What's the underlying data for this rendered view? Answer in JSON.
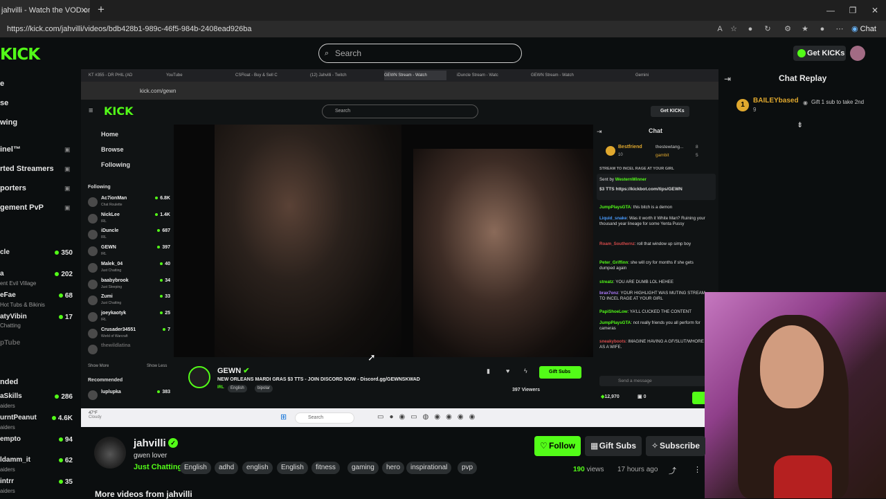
{
  "browser": {
    "tab_title": "jahvilli - Watch the VOD on K",
    "url": "https://kick.com/jahvilli/videos/bdb428b1-989c-46f5-984b-2408ead926ba",
    "chat_button": "Chat"
  },
  "header": {
    "logo": "KICK",
    "search_placeholder": "Search",
    "get_kicks": "Get KICKs"
  },
  "sidebar": {
    "nav": [
      "e",
      "se",
      "wing"
    ],
    "pinned": [
      "inel™",
      "rted Streamers",
      "porters",
      "gement PvP"
    ],
    "streams": [
      {
        "name": "cle",
        "sub": "",
        "count": "350"
      },
      {
        "name": "a",
        "sub": "ent Evil Village",
        "count": "202"
      },
      {
        "name": "eFae",
        "sub": "Hot Tubs & Bikinis",
        "count": "68"
      },
      {
        "name": "atyVibin",
        "sub": "Chatting",
        "count": "17"
      },
      {
        "name": "pTube",
        "sub": "",
        "count": ""
      }
    ],
    "section2": "nded",
    "streams2": [
      {
        "name": "aSkills",
        "sub": "aiders",
        "count": "286"
      },
      {
        "name": "urntPeanut",
        "sub": "aiders",
        "count": "4.6K"
      },
      {
        "name": "empto",
        "sub": "",
        "count": "94"
      },
      {
        "name": "ldamm_it",
        "sub": "aiders",
        "count": "62"
      },
      {
        "name": "intrr",
        "sub": "aiders",
        "count": "35"
      }
    ]
  },
  "embedded": {
    "tabs": [
      "KT #355 - DR PHIL (AD",
      "YouTube",
      "CSFloat - Buy & Sell C",
      "(12) Jahvilli - Twitch",
      "GEWN Stream - Watch",
      "iDuncle Stream - Watc",
      "GEWN Stream - Watch",
      "Gemini"
    ],
    "url": "kick.com/gewn",
    "logo": "KICK",
    "search": "Search",
    "get_kicks": "Get KICKs",
    "nav": [
      "Home",
      "Browse",
      "Following"
    ],
    "following_header": "Following",
    "following": [
      {
        "name": "Ac7ionMan",
        "sub": "Chat Roulette",
        "count": "6.8K"
      },
      {
        "name": "NickLee",
        "sub": "IRL",
        "count": "1.4K"
      },
      {
        "name": "iDuncle",
        "sub": "IRL",
        "count": "687"
      },
      {
        "name": "GEWN",
        "sub": "IRL",
        "count": "397"
      },
      {
        "name": "Malek_04",
        "sub": "Just Chatting",
        "count": "40"
      },
      {
        "name": "baabybrook",
        "sub": "Just Sleeping",
        "count": "34"
      },
      {
        "name": "Zumi",
        "sub": "Just Chatting",
        "count": "33"
      },
      {
        "name": "joeykaotyk",
        "sub": "IRL",
        "count": "25"
      },
      {
        "name": "Crusader34551",
        "sub": "World of Warcraft",
        "count": "7"
      },
      {
        "name": "thewildlatina",
        "sub": "",
        "count": ""
      }
    ],
    "show_more": "Show More",
    "show_less": "Show Less",
    "recommended": "Recommended",
    "rec_stream": {
      "name": "luplupka",
      "count": "383"
    },
    "streamer": "GEWN",
    "title": "NEW ORLEANS MARDI GRAS $3 TTS - JOIN DISCORD NOW - Discord.gg/GEWNSKWAD",
    "tags": [
      "IRL",
      "English",
      "bipolar"
    ],
    "gift_subs": "Gift Subs",
    "viewers": "397 Viewers",
    "chat_title": "Chat",
    "chat_top": [
      {
        "name": "Bestfriend",
        "count": "10"
      },
      {
        "name": "thestewtang...",
        "count": "8"
      },
      {
        "name": "gambit",
        "count": "5"
      }
    ],
    "pinned_line": "STREAM TO INCEL RAGE AT YOUR GIRL",
    "pinned_sender": "Sent by",
    "pinned_user": "WesternWinner",
    "pinned_text": "$3 TTS https://kickbot.com/tips/GEWN",
    "messages": [
      {
        "user": "JumpPlaysGTA",
        "color": "#53fc18",
        "text": "this bitch is a demon"
      },
      {
        "user": "Liquid_snake",
        "color": "#4a9cff",
        "text": "Was it worth it White Man? Ruining your thousand year lineage for some Yenta Pussy"
      },
      {
        "user": "Roam_Southernz",
        "color": "#d64a4a",
        "text": "roll that window up simp boy"
      },
      {
        "user": "Peter_Griffinn",
        "color": "#53fc18",
        "text": "she will cry for months if she gets dumped again"
      },
      {
        "user": "streatz",
        "color": "#53fc18",
        "text": "YOU ARE DUMB LOL HEHEE"
      },
      {
        "user": "brax7onz",
        "color": "#b07cff",
        "text": "YOUR HIGHLIGHT WAS MUTING STREAM TO INCEL RAGE AT YOUR GIRL"
      },
      {
        "user": "PapiShoeLow",
        "color": "#53fc18",
        "text": "YA'LL CUCKED THE CONTENT"
      },
      {
        "user": "JumpPlaysGTA",
        "color": "#53fc18",
        "text": "not really friends you all perform for cameras"
      },
      {
        "user": "sneakyboots",
        "color": "#d64a4a",
        "text": "IMAGINE HAVING A GF/SLUT/WHORE AS A WIFE."
      }
    ],
    "send_placeholder": "Send a message",
    "kicks_balance": "12,970",
    "zero": "0",
    "taskbar_search": "Search",
    "weather": "47°F",
    "weather_sub": "Cloudy"
  },
  "chat_replay": {
    "title": "Chat Replay",
    "badge": "1",
    "user": "BAILEYbased",
    "count": "9",
    "message": "Gift 1 sub to take 2nd"
  },
  "vod": {
    "channel": "jahvilli",
    "subtitle": "gwen lover",
    "category": "Just Chatting",
    "tags": [
      "English",
      "adhd",
      "english",
      "English",
      "fitness",
      "gaming",
      "hero",
      "inspirational",
      "pvp"
    ],
    "follow": "Follow",
    "gift_subs": "Gift Subs",
    "subscribe": "Subscribe",
    "views": "190",
    "views_label": "views",
    "ago": "17 hours ago",
    "more_videos": "More videos from jahvilli"
  },
  "colors": {
    "accent": "#53fc18",
    "background": "#0b0e0f"
  }
}
